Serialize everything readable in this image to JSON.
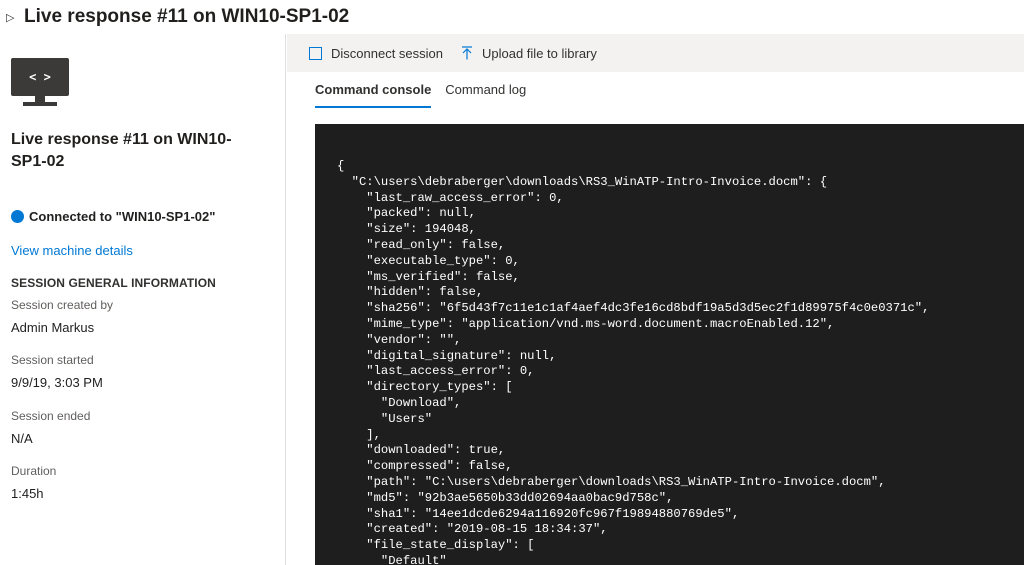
{
  "title": {
    "text": "Live response #11 on WIN10-SP1-02"
  },
  "sidebar": {
    "monitor_glyph": "< >",
    "title": "Live response #11 on WIN10-SP1-02",
    "status_text": "Connected to \"WIN10-SP1-02\"",
    "status_color": "#0078d4",
    "machine_link": "View machine details",
    "section_heading": "SESSION GENERAL INFORMATION",
    "info": [
      {
        "label": "Session created by",
        "value": "Admin Markus"
      },
      {
        "label": "Session started",
        "value": "9/9/19, 3:03 PM"
      },
      {
        "label": "Session ended",
        "value": "N/A"
      },
      {
        "label": "Duration",
        "value": "1:45h"
      }
    ]
  },
  "toolbar": {
    "disconnect_label": "Disconnect session",
    "upload_label": "Upload file to library"
  },
  "tabs": [
    {
      "label": "Command console",
      "active": true
    },
    {
      "label": "Command log",
      "active": false
    }
  ],
  "console": {
    "lines": [
      "{",
      "  \"C:\\users\\debraberger\\downloads\\RS3_WinATP-Intro-Invoice.docm\": {",
      "    \"last_raw_access_error\": 0,",
      "    \"packed\": null,",
      "    \"size\": 194048,",
      "    \"read_only\": false,",
      "    \"executable_type\": 0,",
      "    \"ms_verified\": false,",
      "    \"hidden\": false,",
      "    \"sha256\": \"6f5d43f7c11e1c1af4aef4dc3fe16cd8bdf19a5d3d5ec2f1d89975f4c0e0371c\",",
      "    \"mime_type\": \"application/vnd.ms-word.document.macroEnabled.12\",",
      "    \"vendor\": \"\",",
      "    \"digital_signature\": null,",
      "    \"last_access_error\": 0,",
      "    \"directory_types\": [",
      "      \"Download\",",
      "      \"Users\"",
      "    ],",
      "    \"downloaded\": true,",
      "    \"compressed\": false,",
      "    \"path\": \"C:\\users\\debraberger\\downloads\\RS3_WinATP-Intro-Invoice.docm\",",
      "    \"md5\": \"92b3ae5650b33dd02694aa0bac9d758c\",",
      "    \"sha1\": \"14ee1dcde6294a116920fc967f19894880769de5\",",
      "    \"created\": \"2019-08-15 18:34:37\",",
      "    \"file_state_display\": [",
      "      \"Default\""
    ]
  }
}
